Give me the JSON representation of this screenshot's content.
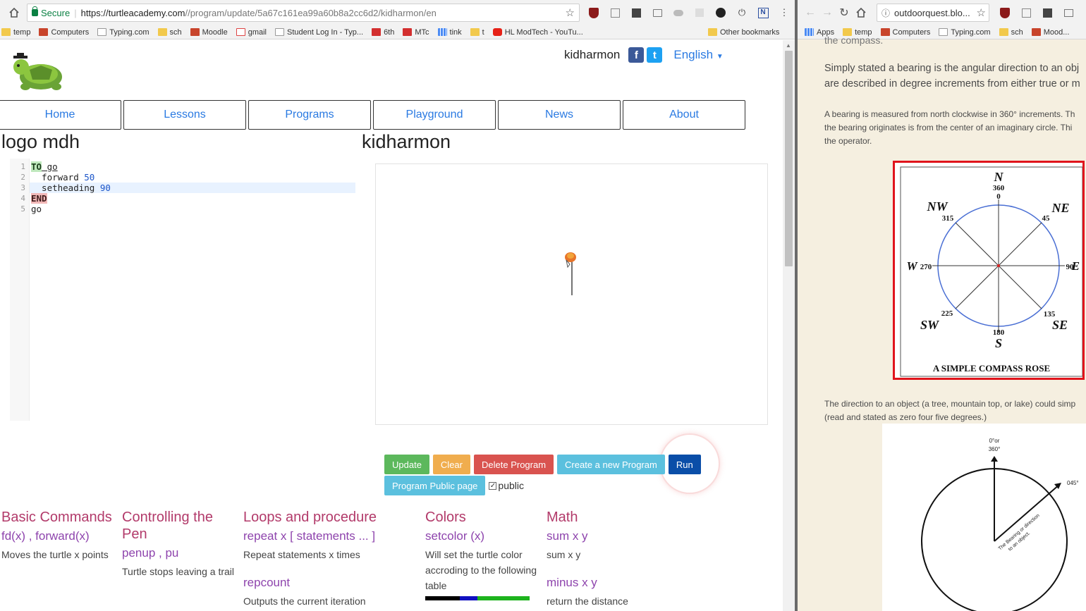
{
  "left_browser": {
    "url_secure_label": "Secure",
    "url_host": "https://turtleacademy.com",
    "url_path": "//program/update/5a67c161ea99a60b8a2cc6d2/kidharmon/en",
    "bookmarks": [
      "temp",
      "Computers",
      "Typing.com",
      "sch",
      "Moodle",
      "gmail",
      "Student Log In - Typ...",
      "6th",
      "MTc",
      "tink",
      "t",
      "HL ModTech - YouTu..."
    ],
    "other_bookmarks": "Other bookmarks"
  },
  "site": {
    "username": "kidharmon",
    "social_fb": "f",
    "social_tw": "t",
    "language": "English",
    "nav": [
      "Home",
      "Lessons",
      "Programs",
      "Playground",
      "News",
      "About"
    ],
    "program_title": "logo mdh",
    "owner_title": "kidharmon"
  },
  "editor": {
    "line_numbers": [
      "1",
      "2",
      "3",
      "4",
      "5"
    ],
    "line1_kw": "TO",
    "line1_rest": " go",
    "line2_cmd": "  forward ",
    "line2_num": "50",
    "line3_cmd": "  setheading ",
    "line3_num": "90",
    "line4_kw": "END",
    "line5": "go"
  },
  "buttons": {
    "update": "Update",
    "clear": "Clear",
    "delete": "Delete Program",
    "create": "Create a new Program",
    "run": "Run",
    "public_page": "Program Public page",
    "public_checkbox": "public",
    "public_checked": true
  },
  "reference": {
    "basic": {
      "heading": "Basic Commands",
      "cmd": "fd(x) , forward(x)",
      "desc": "Moves the turtle x points"
    },
    "pen": {
      "heading": "Controlling the Pen",
      "cmd": "penup , pu",
      "desc": "Turtle stops leaving a trail"
    },
    "loops": {
      "heading": "Loops and procedure",
      "cmd": "repeat x [ statements ... ]",
      "desc": "Repeat statements x times",
      "cmd2": "repcount",
      "desc2": "Outputs the current iteration"
    },
    "colors": {
      "heading": "Colors",
      "cmd": "setcolor (x)",
      "desc": "Will set the turtle color accroding to the following table"
    },
    "math": {
      "heading": "Math",
      "cmd": "sum x y",
      "desc": "sum x y",
      "cmd2": "minus x y",
      "desc2": "return the distance"
    }
  },
  "right_browser": {
    "url": "outdoorquest.blo...",
    "bookmarks": [
      "Apps",
      "temp",
      "Computers",
      "Typing.com",
      "sch",
      "Mood..."
    ],
    "cut_line": "the compass.",
    "para1_l1": "Simply stated a bearing is the angular direction to an obj",
    "para1_l2": "are described in degree increments from either true or m",
    "para2_l1": "A bearing is measured from north clockwise in 360° increments.  Th",
    "para2_l2": "the bearing originates is from the center of an imaginary circle.  Thi",
    "para2_l3": "the operator.",
    "para3_l1": "The direction to an object (a tree, mountain top, or lake) could simp",
    "para3_l2": "(read and stated as zero four five degrees.)",
    "compass": {
      "caption": "A SIMPLE COMPASS ROSE",
      "n": "N",
      "n360": "360",
      "n0": "0",
      "ne": "NE",
      "ne45": "45",
      "e90": "90",
      "e": "E",
      "se": "SE",
      "se135": "135",
      "s180": "180",
      "s": "S",
      "sw": "SW",
      "sw225": "225",
      "w": "W",
      "w270": "270",
      "nw": "NW",
      "nw315": "315"
    },
    "fig2": {
      "top_l1": "0°or",
      "top_l2": "360°",
      "right": "045°",
      "diag_l1": "The Bearing or direction",
      "diag_l2": "to an object."
    }
  }
}
